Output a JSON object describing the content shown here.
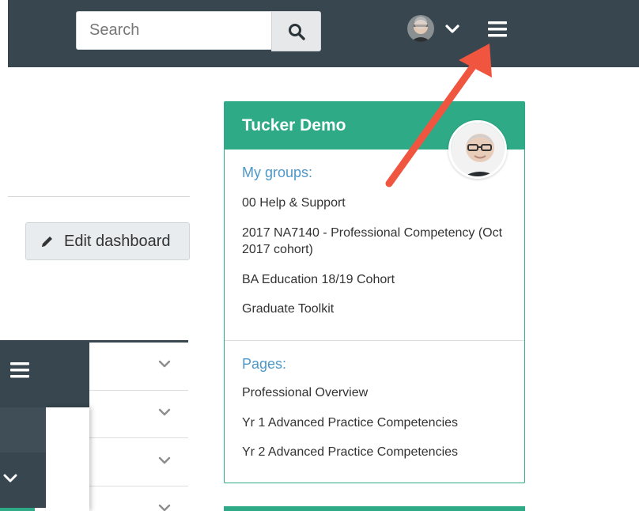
{
  "header": {
    "search": {
      "placeholder": "Search",
      "value": ""
    },
    "icons": [
      "search-icon",
      "user-avatar",
      "chevron-down-icon",
      "hamburger-menu-icon"
    ]
  },
  "main": {
    "edit_dashboard_label": "Edit dashboard"
  },
  "profile_card": {
    "title": "Tucker Demo",
    "groups_heading": "My groups:",
    "groups": [
      "00 Help & Support",
      "2017 NA7140 - Professional Competency (Oct 2017 cohort)",
      "BA Education 18/19 Cohort",
      "Graduate Toolkit"
    ],
    "pages_heading": "Pages:",
    "pages": [
      "Professional Overview",
      "Yr 1 Advanced Practice Competencies",
      "Yr 2 Advanced Practice Competencies"
    ]
  },
  "colors": {
    "topbar": "#37464f",
    "accent_green": "#2eaa87",
    "link_blue": "#4d98c9",
    "annotation_arrow": "#f0553f"
  }
}
